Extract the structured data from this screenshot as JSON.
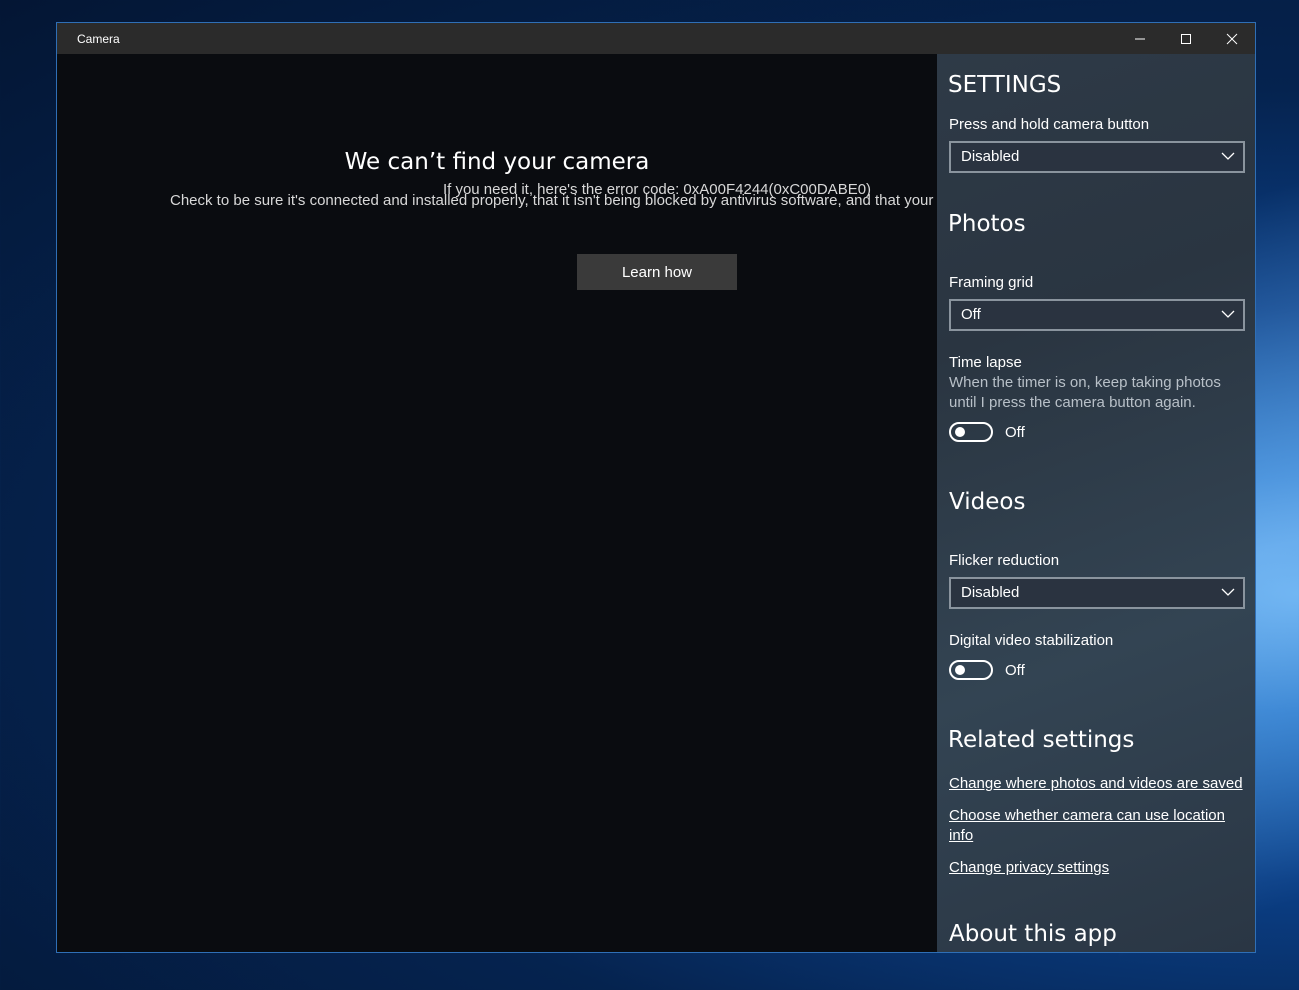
{
  "window": {
    "title": "Camera"
  },
  "main": {
    "error_title": "We can’t find your camera",
    "error_line1": "Check to be sure it's connected and installed properly, that it isn't being blocked by antivirus software, and that your",
    "error_line2": "If you need it, here's the error code: 0xA00F4244(0xC00DABE0)",
    "learn_button": "Learn how"
  },
  "settings": {
    "heading": "SETTINGS",
    "camera_button": {
      "label": "Press and hold camera button",
      "value": "Disabled"
    },
    "photos": {
      "heading": "Photos",
      "framing_grid": {
        "label": "Framing grid",
        "value": "Off"
      },
      "time_lapse": {
        "label": "Time lapse",
        "description": "When the timer is on, keep taking photos until I press the camera button again.",
        "state": "Off"
      }
    },
    "videos": {
      "heading": "Videos",
      "flicker_reduction": {
        "label": "Flicker reduction",
        "value": "Disabled"
      },
      "stabilization": {
        "label": "Digital video stabilization",
        "state": "Off"
      }
    },
    "related": {
      "heading": "Related settings",
      "links": [
        "Change where photos and videos are saved",
        "Choose whether camera can use location info",
        "Change privacy settings"
      ]
    },
    "about_heading": "About this app"
  },
  "colors": {
    "settings_panel": "#2e3a47",
    "camera_area": "#0a0c10",
    "title_bar": "#2b2b2b",
    "button_bg": "#3a3a3a",
    "window_border": "#2f6fb6"
  },
  "icons": [
    "minimize-icon",
    "maximize-icon",
    "close-icon",
    "chevron-down-icon"
  ]
}
